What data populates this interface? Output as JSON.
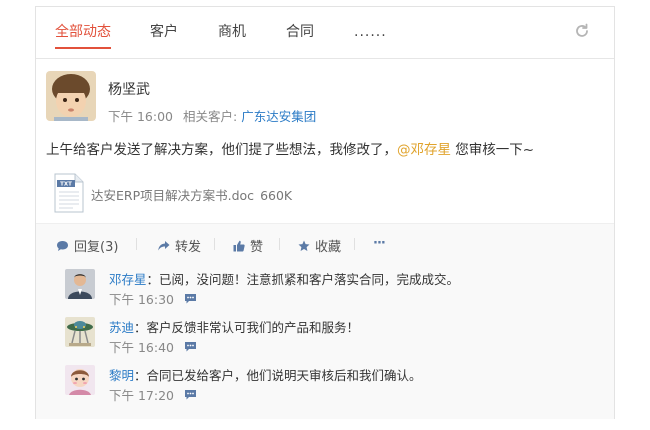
{
  "tabs": [
    {
      "label": "全部动态",
      "active": true
    },
    {
      "label": "客户"
    },
    {
      "label": "商机"
    },
    {
      "label": "合同"
    },
    {
      "label": "......"
    }
  ],
  "post": {
    "author": "杨坚武",
    "time": "下午 16:00",
    "related_label": "相关客户:",
    "related_customer": "广东达安集团",
    "content_before": "上午给客户发送了解决方案，他们提了些想法，我修改了，",
    "mention": "@邓存星",
    "content_after": " 您审核一下~",
    "attachment": {
      "name": "达安ERP项目解决方案书.doc",
      "size": "660K",
      "icon": "txt-file-icon"
    }
  },
  "actions": [
    {
      "label": "回复(3)",
      "icon": "comment-icon"
    },
    {
      "label": "转发",
      "icon": "share-icon"
    },
    {
      "label": "赞",
      "icon": "thumbs-up-icon"
    },
    {
      "label": "收藏",
      "icon": "star-icon"
    },
    {
      "label": "···",
      "icon": "more-icon"
    }
  ],
  "replies": [
    {
      "name": "邓存星",
      "text": "：已阅，没问题！注意抓紧和客户落实合同，完成成交。",
      "time": "下午 16:30"
    },
    {
      "name": "苏迪",
      "text": "：客户反馈非常认可我们的产品和服务！",
      "time": "下午 16:40"
    },
    {
      "name": "黎明",
      "text": "：合同已发给客户，他们说明天审核后和我们确认。",
      "time": "下午 17:20"
    }
  ],
  "colors": {
    "accent": "#e2513b",
    "link": "#2b7bc6",
    "mention": "#e0a32c",
    "icon": "#5b7aa6"
  }
}
